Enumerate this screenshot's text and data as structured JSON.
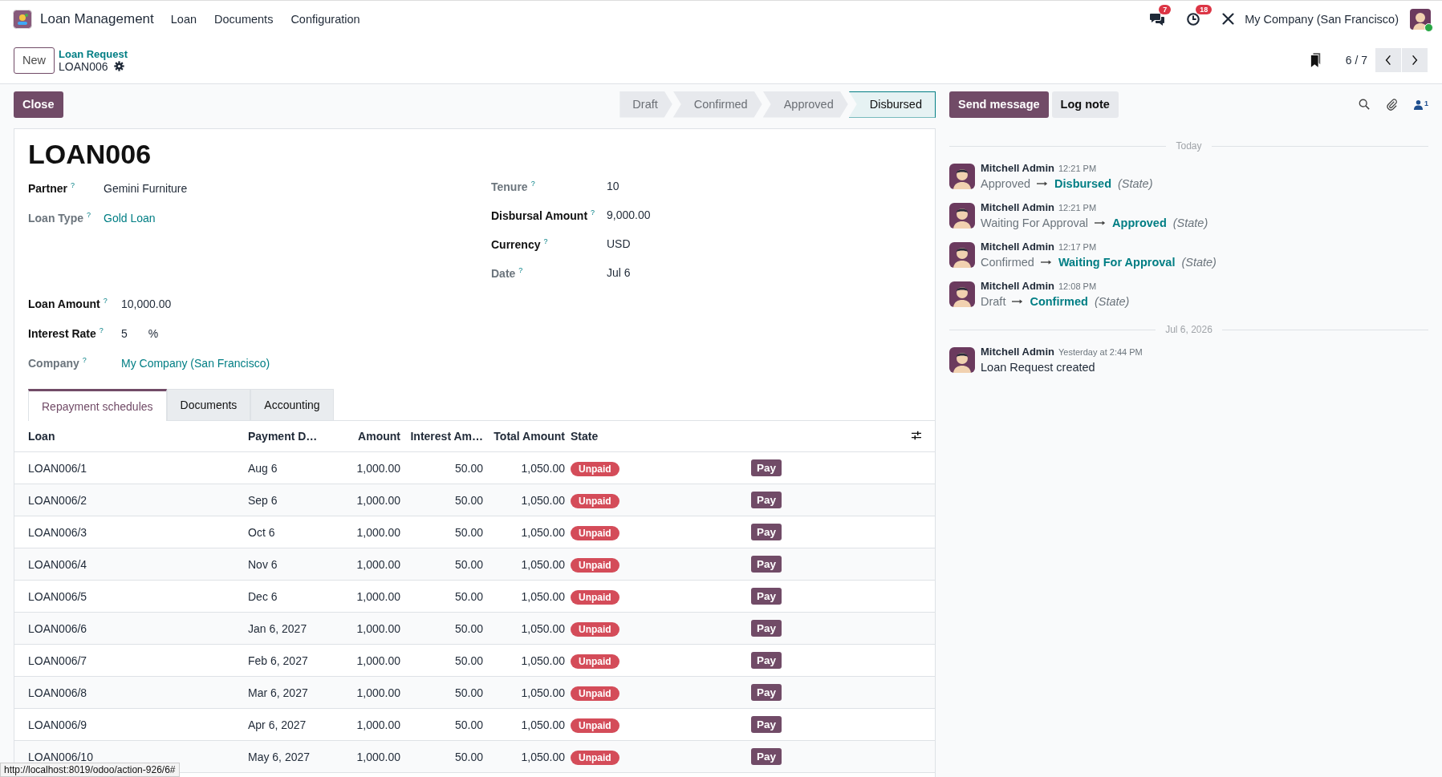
{
  "app": {
    "name": "Loan Management",
    "menu": [
      "Loan",
      "Documents",
      "Configuration"
    ]
  },
  "systray": {
    "messages_count": "7",
    "activities_count": "18",
    "company": "My Company (San Francisco)"
  },
  "control_panel": {
    "new_button": "New",
    "breadcrumb": "Loan Request",
    "record": "LOAN006",
    "pager": "6 / 7"
  },
  "close_button": "Close",
  "statusbar": [
    {
      "label": "Draft",
      "selected": false
    },
    {
      "label": "Confirmed",
      "selected": false
    },
    {
      "label": "Approved",
      "selected": false
    },
    {
      "label": "Disbursed",
      "selected": true
    }
  ],
  "form": {
    "title": "LOAN006",
    "left_fields": [
      {
        "label": "Partner",
        "help": "?",
        "value": "Gemini Furniture",
        "required": true,
        "kind": "text"
      },
      {
        "label": "Loan Type",
        "help": "?",
        "value": "Gold Loan",
        "required": false,
        "kind": "link"
      }
    ],
    "right_fields": [
      {
        "label": "Tenure",
        "help": "?",
        "value": "10",
        "required": false,
        "kind": "text"
      },
      {
        "label": "Disbursal Amount",
        "help": "?",
        "value": "9,000.00",
        "required": true,
        "kind": "text"
      },
      {
        "label": "Currency",
        "help": "?",
        "value": "USD",
        "required": true,
        "kind": "text"
      },
      {
        "label": "Date",
        "help": "?",
        "value": "Jul 6",
        "required": false,
        "kind": "text"
      }
    ],
    "lower_fields": [
      {
        "label": "Loan Amount",
        "help": "?",
        "value": "10,000.00",
        "required": true,
        "kind": "text"
      },
      {
        "label": "Interest Rate",
        "help": "?",
        "value": "5",
        "suffix": "%",
        "required": true,
        "kind": "text"
      },
      {
        "label": "Company",
        "help": "?",
        "value": "My Company (San Francisco)",
        "required": false,
        "kind": "link"
      }
    ]
  },
  "tabs": [
    {
      "label": "Repayment schedules",
      "selected": true
    },
    {
      "label": "Documents",
      "selected": false
    },
    {
      "label": "Accounting",
      "selected": false
    }
  ],
  "table": {
    "columns": [
      "Loan",
      "Payment D…",
      "Amount",
      "Interest Am…",
      "Total Amount",
      "State"
    ],
    "rows": [
      {
        "loan": "LOAN006/1",
        "date": "Aug 6",
        "amount": "1,000.00",
        "interest": "50.00",
        "total": "1,050.00",
        "state": "Unpaid",
        "action": "Pay"
      },
      {
        "loan": "LOAN006/2",
        "date": "Sep 6",
        "amount": "1,000.00",
        "interest": "50.00",
        "total": "1,050.00",
        "state": "Unpaid",
        "action": "Pay"
      },
      {
        "loan": "LOAN006/3",
        "date": "Oct 6",
        "amount": "1,000.00",
        "interest": "50.00",
        "total": "1,050.00",
        "state": "Unpaid",
        "action": "Pay"
      },
      {
        "loan": "LOAN006/4",
        "date": "Nov 6",
        "amount": "1,000.00",
        "interest": "50.00",
        "total": "1,050.00",
        "state": "Unpaid",
        "action": "Pay"
      },
      {
        "loan": "LOAN006/5",
        "date": "Dec 6",
        "amount": "1,000.00",
        "interest": "50.00",
        "total": "1,050.00",
        "state": "Unpaid",
        "action": "Pay"
      },
      {
        "loan": "LOAN006/6",
        "date": "Jan 6, 2027",
        "amount": "1,000.00",
        "interest": "50.00",
        "total": "1,050.00",
        "state": "Unpaid",
        "action": "Pay"
      },
      {
        "loan": "LOAN006/7",
        "date": "Feb 6, 2027",
        "amount": "1,000.00",
        "interest": "50.00",
        "total": "1,050.00",
        "state": "Unpaid",
        "action": "Pay"
      },
      {
        "loan": "LOAN006/8",
        "date": "Mar 6, 2027",
        "amount": "1,000.00",
        "interest": "50.00",
        "total": "1,050.00",
        "state": "Unpaid",
        "action": "Pay"
      },
      {
        "loan": "LOAN006/9",
        "date": "Apr 6, 2027",
        "amount": "1,000.00",
        "interest": "50.00",
        "total": "1,050.00",
        "state": "Unpaid",
        "action": "Pay"
      },
      {
        "loan": "LOAN006/10",
        "date": "May 6, 2027",
        "amount": "1,000.00",
        "interest": "50.00",
        "total": "1,050.00",
        "state": "Unpaid",
        "action": "Pay"
      }
    ]
  },
  "chatter": {
    "send_message": "Send message",
    "log_note": "Log note",
    "followers_count": "1",
    "groups": [
      {
        "date": "Today",
        "messages": [
          {
            "kind": "tracking",
            "author": "Mitchell Admin",
            "time": "12:21 PM",
            "old": "Approved",
            "new": "Disbursed",
            "field": "(State)"
          },
          {
            "kind": "tracking",
            "author": "Mitchell Admin",
            "time": "12:21 PM",
            "old": "Waiting For Approval",
            "new": "Approved",
            "field": "(State)"
          },
          {
            "kind": "tracking",
            "author": "Mitchell Admin",
            "time": "12:17 PM",
            "old": "Confirmed",
            "new": "Waiting For Approval",
            "field": "(State)"
          },
          {
            "kind": "tracking",
            "author": "Mitchell Admin",
            "time": "12:08 PM",
            "old": "Draft",
            "new": "Confirmed",
            "field": "(State)"
          }
        ]
      },
      {
        "date": "Jul 6, 2026",
        "messages": [
          {
            "kind": "note",
            "author": "Mitchell Admin",
            "time": "Yesterday at 2:44 PM",
            "body": "Loan Request created"
          }
        ]
      }
    ]
  },
  "status_url": "http://localhost:8019/odoo/action-926/6#"
}
